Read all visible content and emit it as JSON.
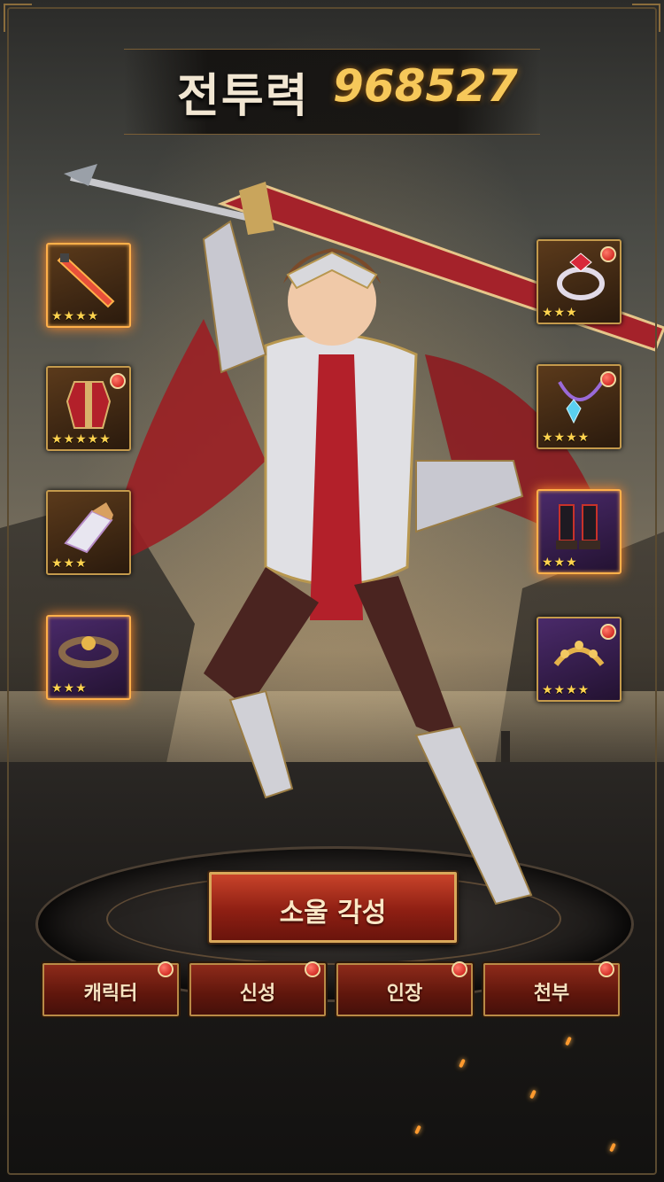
{
  "header": {
    "power_label": "전투력",
    "power_value": "968527"
  },
  "equipment_left": [
    {
      "slot": "weapon",
      "icon": "sword-icon",
      "stars": "★★★★",
      "glow": true,
      "badge": false
    },
    {
      "slot": "armor",
      "icon": "armor-icon",
      "stars": "★★★★★",
      "glow": false,
      "badge": true
    },
    {
      "slot": "gauntlet",
      "icon": "gauntlet-icon",
      "stars": "★★★",
      "glow": false,
      "badge": true
    },
    {
      "slot": "belt",
      "icon": "belt-icon",
      "stars": "★★★",
      "glow": true,
      "badge": false
    }
  ],
  "equipment_right": [
    {
      "slot": "ring",
      "icon": "ring-icon",
      "stars": "★★★",
      "glow": false,
      "badge": true
    },
    {
      "slot": "necklace",
      "icon": "necklace-icon",
      "stars": "★★★★",
      "glow": false,
      "badge": true
    },
    {
      "slot": "boots",
      "icon": "boots-icon",
      "stars": "★★★",
      "glow": true,
      "badge": false
    },
    {
      "slot": "laurel",
      "icon": "laurel-icon",
      "stars": "★★★★",
      "glow": false,
      "badge": true
    }
  ],
  "actions": {
    "awaken_label": "소울 각성"
  },
  "tabs": [
    {
      "label": "캐릭터",
      "badge": true
    },
    {
      "label": "신성",
      "badge": true
    },
    {
      "label": "인장",
      "badge": true
    },
    {
      "label": "천부",
      "badge": true
    }
  ],
  "colors": {
    "accent_gold": "#f6c85a",
    "button_red": "#8e1f13",
    "badge_red": "#c4100c",
    "star_yellow": "#ffd34e"
  }
}
